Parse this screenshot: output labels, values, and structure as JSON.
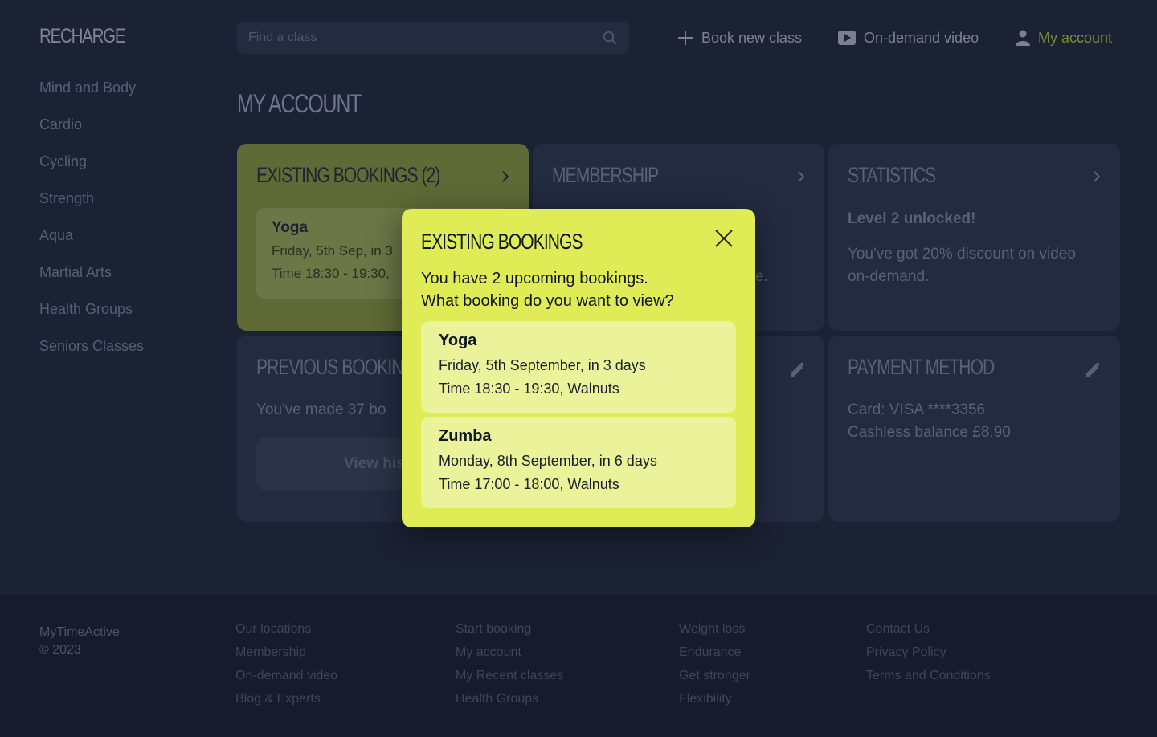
{
  "app": {
    "logo": "RECHARGE"
  },
  "sidebar": {
    "items": [
      {
        "label": "Mind and Body"
      },
      {
        "label": "Cardio"
      },
      {
        "label": "Cycling"
      },
      {
        "label": "Strength"
      },
      {
        "label": "Aqua"
      },
      {
        "label": "Martial Arts"
      },
      {
        "label": "Health Groups"
      },
      {
        "label": "Seniors Classes"
      }
    ]
  },
  "header": {
    "search_placeholder": "Find a class",
    "search_value": "",
    "book_label": "Book new class",
    "video_label": "On-demand video",
    "account_label": "My account",
    "account_color": "#7d8938"
  },
  "page": {
    "title": "MY ACCOUNT"
  },
  "cards": {
    "existing": {
      "title": "EXISTING BOOKINGS (2)",
      "preview_title": "Yoga",
      "preview_line1": "Friday, 5th Sep, in 3",
      "preview_line2": "Time 18:30 - 19:30,"
    },
    "membership": {
      "title": "MEMBERSHIP",
      "visible_fragment": "e."
    },
    "statistics": {
      "title": "STATISTICS",
      "headline": "Level 2 unlocked!",
      "body": "You've got 20% discount on video on-demand."
    },
    "previous": {
      "title": "PREVIOUS BOOKING",
      "body": "You've made 37 bo",
      "button": "View hist"
    },
    "payment": {
      "title": "PAYMENT METHOD",
      "card": "Card: VISA ****3356",
      "balance": "Cashless balance £8.90"
    }
  },
  "modal": {
    "title": "EXISTING BOOKINGS",
    "line1": "You have 2 upcoming bookings.",
    "line2": "What booking do you want to view?",
    "bookings": [
      {
        "title": "Yoga",
        "date": "Friday, 5th September, in 3 days",
        "time": "Time 18:30 - 19:30, Walnuts"
      },
      {
        "title": "Zumba",
        "date": "Monday, 8th September, in 6 days",
        "time": "Time 17:00 - 18:00, Walnuts"
      }
    ],
    "accent_color": "#dfec55"
  },
  "footer": {
    "brand": "MyTimeActive",
    "copyright": "© 2023",
    "col1": [
      "Our locations",
      "Membership",
      "On-demand video",
      "Blog & Experts"
    ],
    "col2": [
      "Start booking",
      "My account",
      "My Recent classes",
      "Health Groups"
    ],
    "col3": [
      "Weight loss",
      "Endurance",
      "Get stronger",
      "Flexibility"
    ],
    "col4": [
      "Contact Us",
      "Privacy Policy",
      "Terms and Conditions"
    ]
  }
}
